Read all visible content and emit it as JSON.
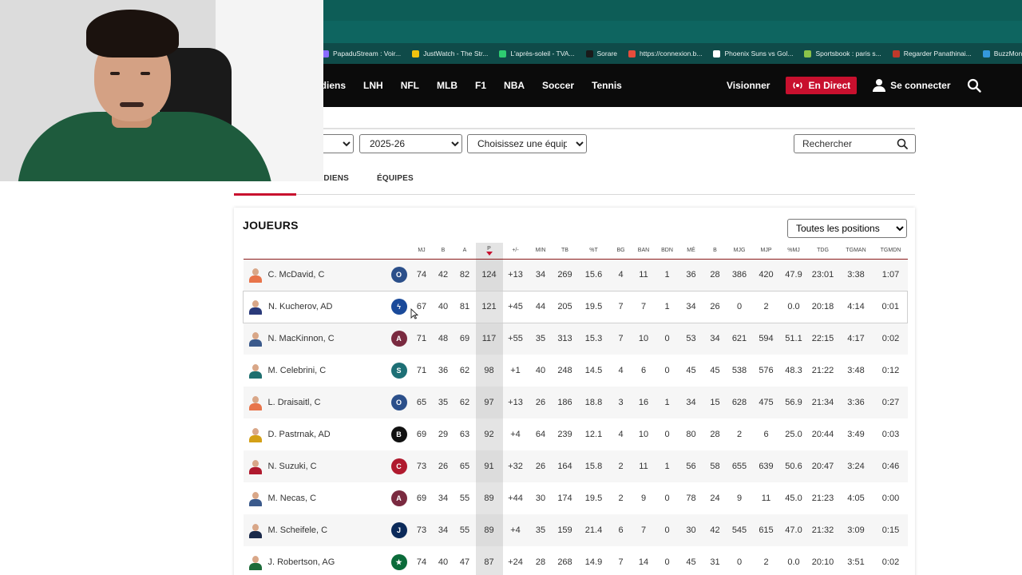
{
  "bookmarks": [
    {
      "label": "PapaduStream : Voir...",
      "color": "#8a6cff"
    },
    {
      "label": "JustWatch - The Str...",
      "color": "#f1c40f"
    },
    {
      "label": "L'après-soleil - TVA...",
      "color": "#2ecc71"
    },
    {
      "label": "Sorare",
      "color": "#1a1a1a"
    },
    {
      "label": "https://connexion.b...",
      "color": "#e74c3c"
    },
    {
      "label": "Phoenix Suns vs Gol...",
      "color": "#ffffff"
    },
    {
      "label": "Sportsbook : paris s...",
      "color": "#8bc34a"
    },
    {
      "label": "Regarder Panathinai...",
      "color": "#c0392b"
    },
    {
      "label": "BuzzMonclick - Le...",
      "color": "#3498db"
    }
  ],
  "nav": {
    "links": [
      "adiens",
      "LNH",
      "NFL",
      "MLB",
      "F1",
      "NBA",
      "Soccer",
      "Tennis"
    ],
    "watch": "Visionner",
    "live": "En Direct",
    "signin": "Se connecter"
  },
  "filters": {
    "season": "2025-26",
    "team": "Choisissez une équipe",
    "search_placeholder": "Rechercher",
    "positions": "Toutes les positions"
  },
  "tabs": {
    "first": "RDIENS",
    "second": "ÉQUIPES"
  },
  "section_title": "JOUEURS",
  "columns": [
    "MJ",
    "B",
    "A",
    "P",
    "+/-",
    "MIN",
    "TB",
    "%T",
    "BG",
    "BAN",
    "BDN",
    "MÉ",
    "B",
    "MJG",
    "MJP",
    "%MJ",
    "TDG",
    "TGMAN",
    "TGMDN"
  ],
  "players": [
    {
      "name": "C. McDavid, C",
      "team": "oilers",
      "jersey": "#e8744a",
      "stats": [
        "74",
        "42",
        "82",
        "124",
        "+13",
        "34",
        "269",
        "15.6",
        "4",
        "11",
        "1",
        "36",
        "28",
        "386",
        "420",
        "47.9",
        "23:01",
        "3:38",
        "1:07"
      ]
    },
    {
      "name": "N. Kucherov, AD",
      "team": "lightning",
      "jersey": "#2a3a7a",
      "stats": [
        "67",
        "40",
        "81",
        "121",
        "+45",
        "44",
        "205",
        "19.5",
        "7",
        "7",
        "1",
        "34",
        "26",
        "0",
        "2",
        "0.0",
        "20:18",
        "4:14",
        "0:01"
      ]
    },
    {
      "name": "N. MacKinnon, C",
      "team": "avalanche",
      "jersey": "#3b5a8c",
      "stats": [
        "71",
        "48",
        "69",
        "117",
        "+55",
        "35",
        "313",
        "15.3",
        "7",
        "10",
        "0",
        "53",
        "34",
        "621",
        "594",
        "51.1",
        "22:15",
        "4:17",
        "0:02"
      ]
    },
    {
      "name": "M. Celebrini, C",
      "team": "sharks",
      "jersey": "#1f6f6f",
      "stats": [
        "71",
        "36",
        "62",
        "98",
        "+1",
        "40",
        "248",
        "14.5",
        "4",
        "6",
        "0",
        "45",
        "45",
        "538",
        "576",
        "48.3",
        "21:22",
        "3:48",
        "0:12"
      ]
    },
    {
      "name": "L. Draisaitl, C",
      "team": "oilers",
      "jersey": "#e8744a",
      "stats": [
        "65",
        "35",
        "62",
        "97",
        "+13",
        "26",
        "186",
        "18.8",
        "3",
        "16",
        "1",
        "34",
        "15",
        "628",
        "475",
        "56.9",
        "21:34",
        "3:36",
        "0:27"
      ]
    },
    {
      "name": "D. Pastrnak, AD",
      "team": "bruins",
      "jersey": "#d4a017",
      "stats": [
        "69",
        "29",
        "63",
        "92",
        "+4",
        "64",
        "239",
        "12.1",
        "4",
        "10",
        "0",
        "80",
        "28",
        "2",
        "6",
        "25.0",
        "20:44",
        "3:49",
        "0:03"
      ]
    },
    {
      "name": "N. Suzuki, C",
      "team": "canadiens",
      "jersey": "#b01a2e",
      "stats": [
        "73",
        "26",
        "65",
        "91",
        "+32",
        "26",
        "164",
        "15.8",
        "2",
        "11",
        "1",
        "56",
        "58",
        "655",
        "639",
        "50.6",
        "20:47",
        "3:24",
        "0:46"
      ]
    },
    {
      "name": "M. Necas, C",
      "team": "avalanche",
      "jersey": "#3b5a8c",
      "stats": [
        "69",
        "34",
        "55",
        "89",
        "+44",
        "30",
        "174",
        "19.5",
        "2",
        "9",
        "0",
        "78",
        "24",
        "9",
        "11",
        "45.0",
        "21:23",
        "4:05",
        "0:00"
      ]
    },
    {
      "name": "M. Scheifele, C",
      "team": "jets",
      "jersey": "#1a2a4a",
      "stats": [
        "73",
        "34",
        "55",
        "89",
        "+4",
        "35",
        "159",
        "21.4",
        "6",
        "7",
        "0",
        "30",
        "42",
        "545",
        "615",
        "47.0",
        "21:32",
        "3:09",
        "0:15"
      ]
    },
    {
      "name": "J. Robertson, AG",
      "team": "stars",
      "jersey": "#1d6b3a",
      "stats": [
        "74",
        "40",
        "47",
        "87",
        "+24",
        "28",
        "268",
        "14.9",
        "7",
        "14",
        "0",
        "45",
        "31",
        "0",
        "2",
        "0.0",
        "20:10",
        "3:51",
        "0:02"
      ]
    }
  ],
  "team_logos": {
    "oilers": {
      "bg": "#2b4f8a",
      "glyph": "O"
    },
    "lightning": {
      "bg": "#1a4a9a",
      "glyph": "ϟ"
    },
    "avalanche": {
      "bg": "#7a2a40",
      "glyph": "A"
    },
    "sharks": {
      "bg": "#1d6f75",
      "glyph": "S"
    },
    "bruins": {
      "bg": "#111111",
      "glyph": "B"
    },
    "canadiens": {
      "bg": "#b01a2e",
      "glyph": "C"
    },
    "jets": {
      "bg": "#0b2a5a",
      "glyph": "J"
    },
    "stars": {
      "bg": "#0b6b3a",
      "glyph": "★"
    }
  },
  "colors": {
    "accent": "#c8102e",
    "nav_bg": "#0b0b0b"
  }
}
